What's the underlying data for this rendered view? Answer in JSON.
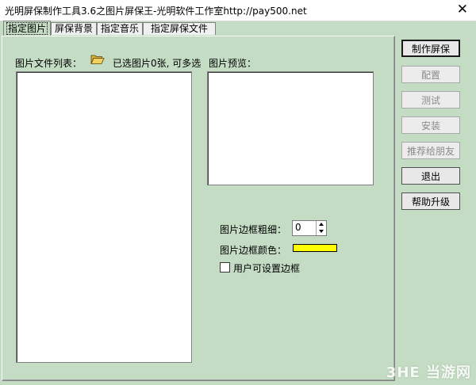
{
  "window": {
    "title": "光明屏保制作工具3.6之图片屏保王-光明软件工作室http://pay500.net",
    "close_symbol": "✕"
  },
  "tabs": [
    {
      "label": "指定图片",
      "active": true
    },
    {
      "label": "屏保背景",
      "active": false
    },
    {
      "label": "指定音乐",
      "active": false
    },
    {
      "label": "指定屏保文件",
      "active": false
    }
  ],
  "panel": {
    "file_list_label": "图片文件列表：",
    "folder_icon": "open-folder-icon",
    "selected_status": "已选图片0张, 可多选",
    "preview_label": "图片预览：",
    "border_width_label": "图片边框粗细：",
    "border_width_value": "0",
    "border_color_label": "图片边框颜色：",
    "border_color": "#ffff00",
    "user_border_label": "用户可设置边框",
    "user_border_checked": false
  },
  "buttons": [
    {
      "label": "制作屏保",
      "enabled": true
    },
    {
      "label": "配置",
      "enabled": false
    },
    {
      "label": "测试",
      "enabled": false
    },
    {
      "label": "安装",
      "enabled": false
    },
    {
      "label": "推荐给朋友",
      "enabled": false
    },
    {
      "label": "退出",
      "enabled": true
    },
    {
      "label": "帮助升级",
      "enabled": true
    }
  ],
  "watermark": "3HE 当游网"
}
